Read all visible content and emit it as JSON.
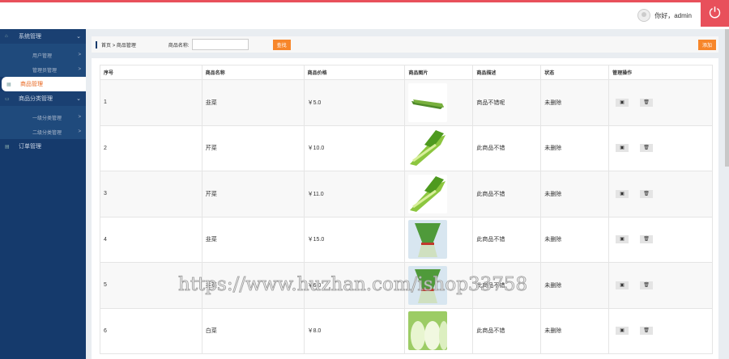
{
  "header": {
    "greeting": "你好，admin",
    "power_icon": "power-icon"
  },
  "sidebar": {
    "items": [
      {
        "label": "系统管理",
        "icon": "⌂",
        "arrow": "⌄",
        "type": "group"
      },
      {
        "label": "用户管理",
        "arrow": ">",
        "type": "sub"
      },
      {
        "label": "管理员管理",
        "arrow": ">",
        "type": "sub"
      },
      {
        "label": "商品管理",
        "icon": "▦",
        "type": "active"
      },
      {
        "label": "商品分类管理",
        "icon": "▭",
        "arrow": "⌄",
        "type": "group"
      },
      {
        "label": "一级分类管理",
        "arrow": ">",
        "type": "sub"
      },
      {
        "label": "二级分类管理",
        "arrow": ">",
        "type": "sub"
      },
      {
        "label": "订单管理",
        "icon": "▤",
        "type": "item"
      }
    ]
  },
  "toolbar": {
    "breadcrumb_home": "首页",
    "breadcrumb_sep": ">",
    "breadcrumb_current": "商品管理",
    "search_label": "商品名称:",
    "search_value": "",
    "search_button": "查找",
    "add_button": "添加"
  },
  "table": {
    "headers": [
      "序号",
      "商品名称",
      "商品价格",
      "商品图片",
      "商品描述",
      "状态",
      "管理操作"
    ],
    "rows": [
      {
        "id": "1",
        "name": "韭菜",
        "price": "￥5.0",
        "desc": "商品不错呢",
        "status": "未删除",
        "img": "chives"
      },
      {
        "id": "2",
        "name": "芹菜",
        "price": "￥10.0",
        "desc": "此商品不错",
        "status": "未删除",
        "img": "celery"
      },
      {
        "id": "3",
        "name": "芹菜",
        "price": "￥11.0",
        "desc": "此商品不错",
        "status": "未删除",
        "img": "celery"
      },
      {
        "id": "4",
        "name": "韭菜",
        "price": "￥15.0",
        "desc": "此商品不错",
        "status": "未删除",
        "img": "chives-bundle"
      },
      {
        "id": "5",
        "name": "韭菜",
        "price": "￥6.0",
        "desc": "此商品不错",
        "status": "未删除",
        "img": "chives-bundle"
      },
      {
        "id": "6",
        "name": "白菜",
        "price": "￥8.0",
        "desc": "此商品不错",
        "status": "未删除",
        "img": "cabbage"
      }
    ]
  },
  "watermark": "https://www.huzhan.com/ishop33758",
  "colors": {
    "accent": "#e8505b",
    "sidebar": "#153a6c",
    "button": "#f7862a"
  }
}
